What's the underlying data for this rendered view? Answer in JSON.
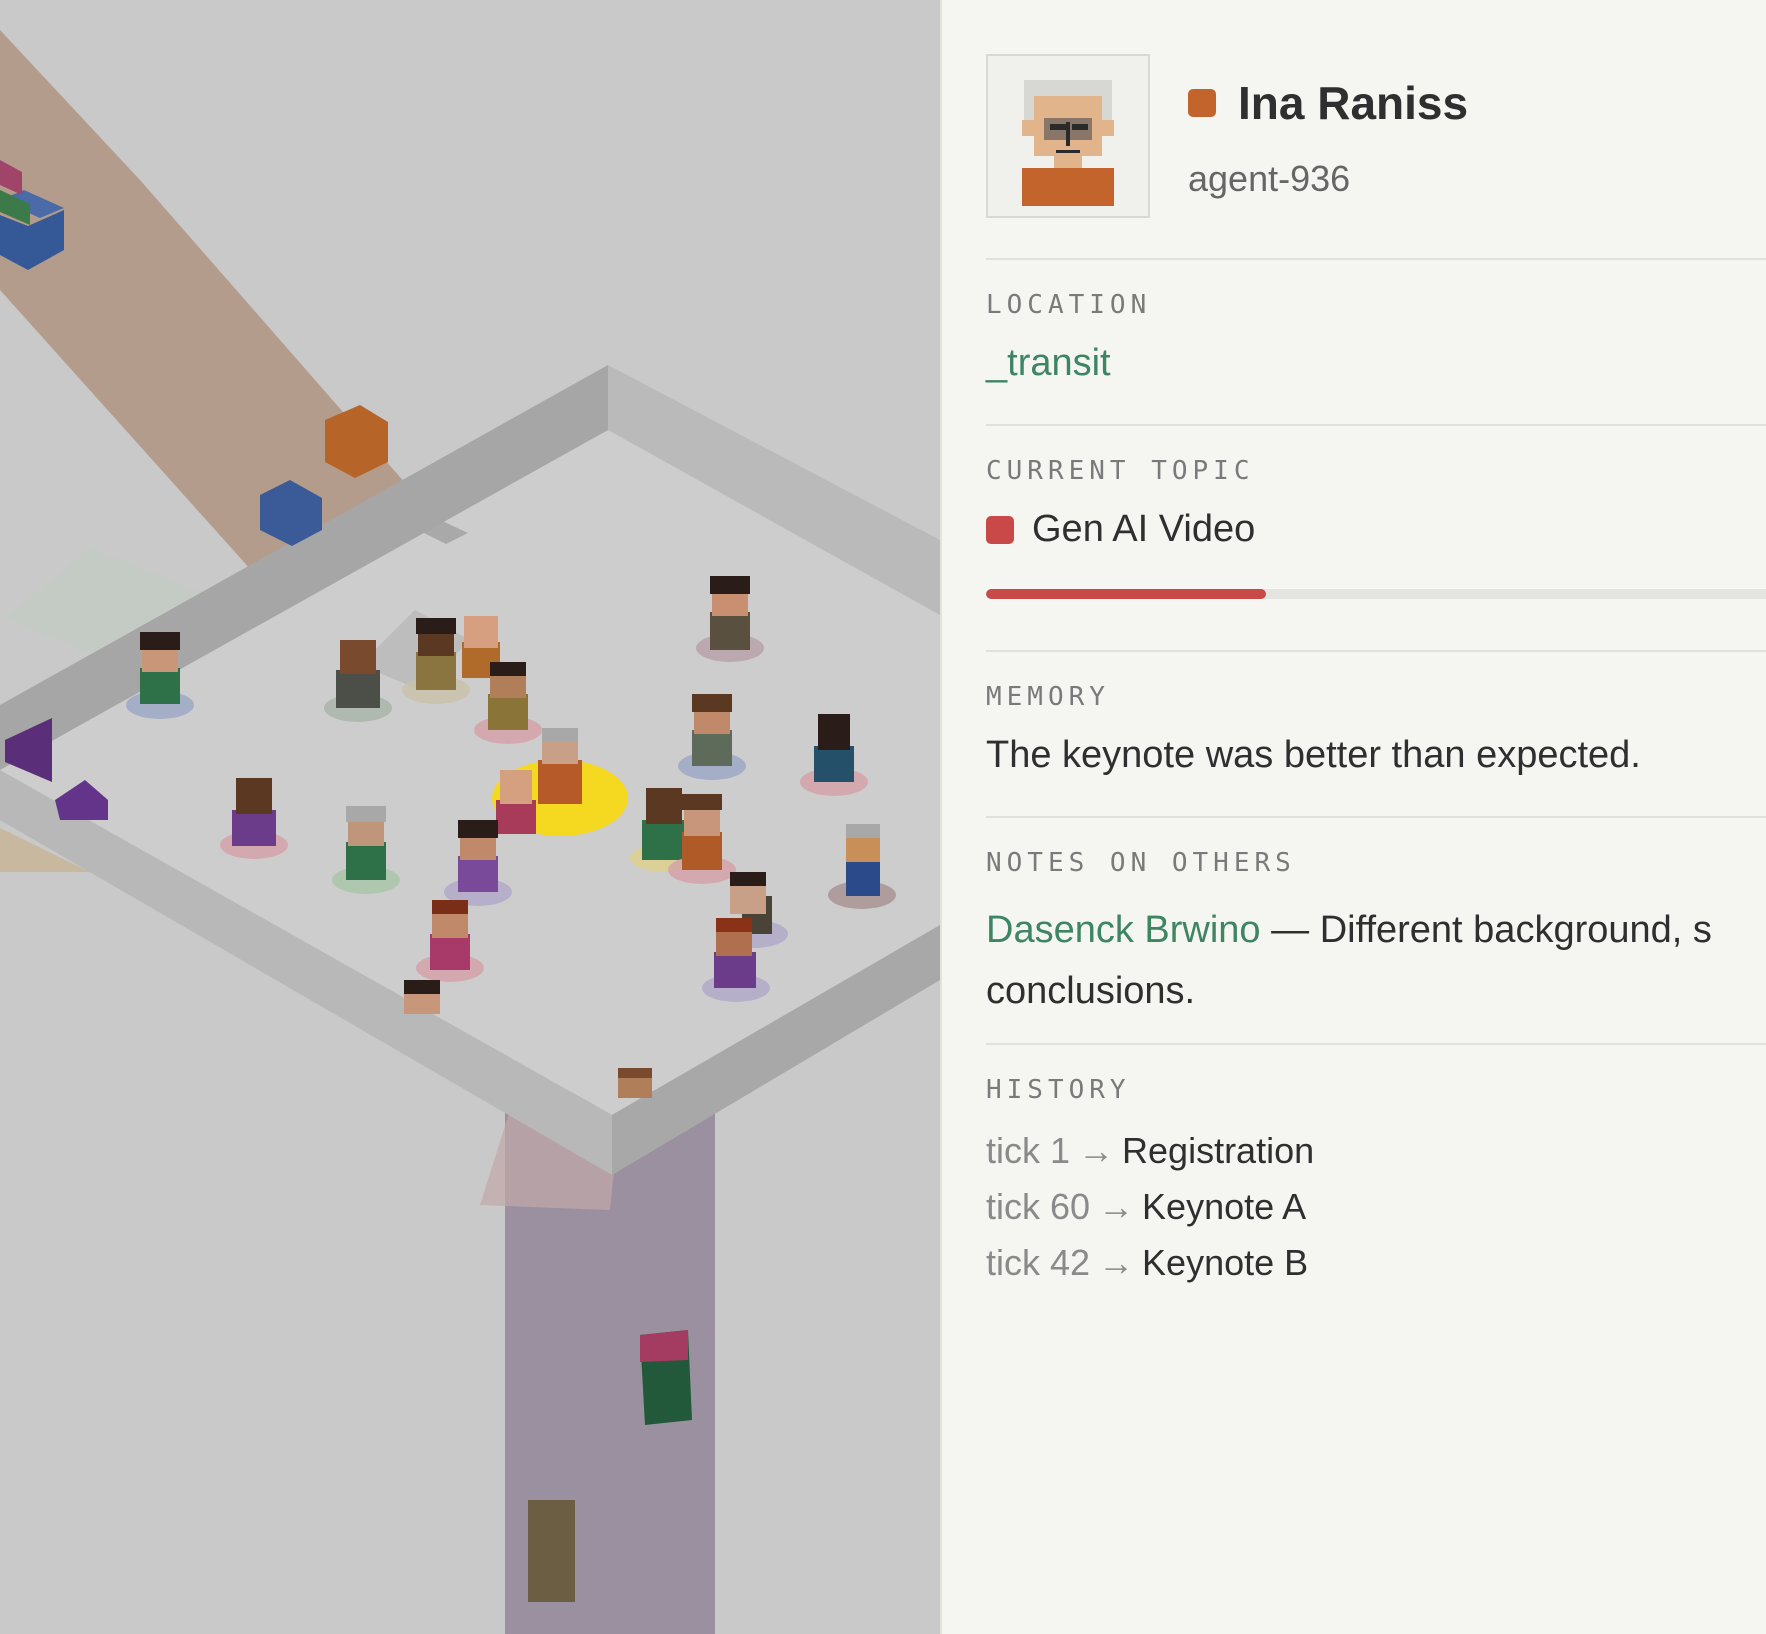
{
  "agent": {
    "name": "Ina Raniss",
    "id": "agent-936",
    "status_color": "#c2642b",
    "avatar": "pixel-portrait-gray-hair-glasses"
  },
  "location": {
    "label": "LOCATION",
    "value": "_transit"
  },
  "current_topic": {
    "label": "CURRENT TOPIC",
    "name": "Gen AI Video",
    "color": "#c94848",
    "progress": 0.35
  },
  "memory": {
    "label": "MEMORY",
    "text": "The keynote was better than expected."
  },
  "notes": {
    "label": "NOTES ON OTHERS",
    "items": [
      {
        "name": "Dasenck Brwino",
        "separator": "—",
        "line1": "Different background, s",
        "line2": "conclusions."
      }
    ]
  },
  "history": {
    "label": "HISTORY",
    "arrow": "→",
    "items": [
      {
        "tick": "tick 1",
        "event": "Registration"
      },
      {
        "tick": "tick 60",
        "event": "Keynote A"
      },
      {
        "tick": "tick 42",
        "event": "Keynote B"
      }
    ]
  },
  "colors": {
    "accent_green": "#3e8563",
    "selection_highlight": "#f5d820",
    "floor": "#cdcdcd",
    "wall": "#b0b0b0",
    "path_brown": "#b49c8c",
    "path_purple": "#9a90a0"
  }
}
